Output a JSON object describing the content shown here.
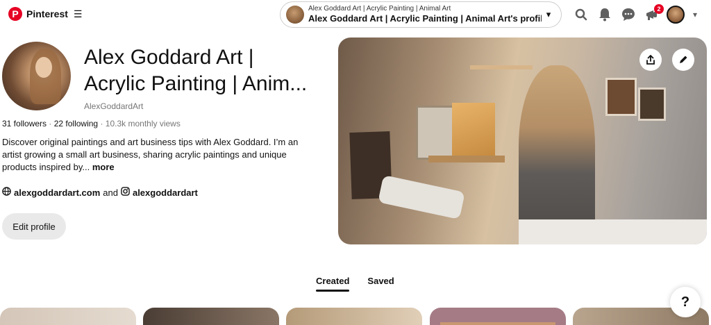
{
  "brand": {
    "name": "Pinterest",
    "color": "#e60023"
  },
  "header": {
    "pill_small": "Alex Goddard Art | Acrylic Painting | Animal Art",
    "pill_title": "Alex Goddard Art | Acrylic Painting | Animal Art's profile",
    "notification_count": "2",
    "icons": [
      "search-icon",
      "bell-icon",
      "chat-icon",
      "updates-icon"
    ]
  },
  "profile": {
    "name_line1": "Alex Goddard Art |",
    "name_line2": "Acrylic Painting | Anim...",
    "username": "AlexGoddardArt",
    "followers": "31 followers",
    "following": "22 following",
    "monthly_views": "10.3k monthly views",
    "bio": "Discover original paintings and art business tips with Alex Goddard. I’m an artist growing a small art business, sharing acrylic paintings and unique products inspired by...",
    "more_label": "more",
    "website": "alexgoddardart.com",
    "and_label": "and",
    "instagram": "alexgoddardart",
    "edit_label": "Edit profile"
  },
  "tabs": [
    {
      "label": "Created",
      "active": true
    },
    {
      "label": "Saved",
      "active": false
    }
  ],
  "help_label": "?"
}
